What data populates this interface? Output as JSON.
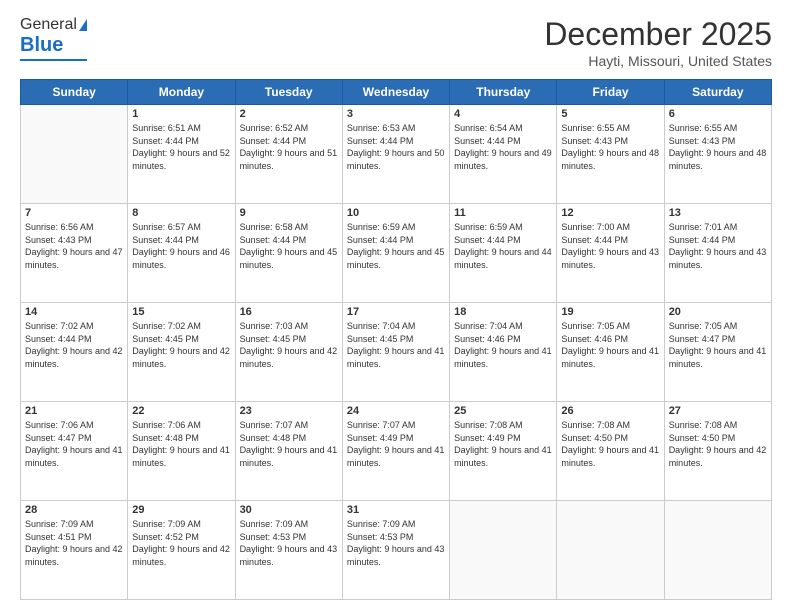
{
  "logo": {
    "line1": "General",
    "line2": "Blue"
  },
  "header": {
    "title": "December 2025",
    "location": "Hayti, Missouri, United States"
  },
  "weekdays": [
    "Sunday",
    "Monday",
    "Tuesday",
    "Wednesday",
    "Thursday",
    "Friday",
    "Saturday"
  ],
  "weeks": [
    [
      {
        "day": "",
        "sunrise": "",
        "sunset": "",
        "daylight": ""
      },
      {
        "day": "1",
        "sunrise": "Sunrise: 6:51 AM",
        "sunset": "Sunset: 4:44 PM",
        "daylight": "Daylight: 9 hours and 52 minutes."
      },
      {
        "day": "2",
        "sunrise": "Sunrise: 6:52 AM",
        "sunset": "Sunset: 4:44 PM",
        "daylight": "Daylight: 9 hours and 51 minutes."
      },
      {
        "day": "3",
        "sunrise": "Sunrise: 6:53 AM",
        "sunset": "Sunset: 4:44 PM",
        "daylight": "Daylight: 9 hours and 50 minutes."
      },
      {
        "day": "4",
        "sunrise": "Sunrise: 6:54 AM",
        "sunset": "Sunset: 4:44 PM",
        "daylight": "Daylight: 9 hours and 49 minutes."
      },
      {
        "day": "5",
        "sunrise": "Sunrise: 6:55 AM",
        "sunset": "Sunset: 4:43 PM",
        "daylight": "Daylight: 9 hours and 48 minutes."
      },
      {
        "day": "6",
        "sunrise": "Sunrise: 6:55 AM",
        "sunset": "Sunset: 4:43 PM",
        "daylight": "Daylight: 9 hours and 48 minutes."
      }
    ],
    [
      {
        "day": "7",
        "sunrise": "Sunrise: 6:56 AM",
        "sunset": "Sunset: 4:43 PM",
        "daylight": "Daylight: 9 hours and 47 minutes."
      },
      {
        "day": "8",
        "sunrise": "Sunrise: 6:57 AM",
        "sunset": "Sunset: 4:44 PM",
        "daylight": "Daylight: 9 hours and 46 minutes."
      },
      {
        "day": "9",
        "sunrise": "Sunrise: 6:58 AM",
        "sunset": "Sunset: 4:44 PM",
        "daylight": "Daylight: 9 hours and 45 minutes."
      },
      {
        "day": "10",
        "sunrise": "Sunrise: 6:59 AM",
        "sunset": "Sunset: 4:44 PM",
        "daylight": "Daylight: 9 hours and 45 minutes."
      },
      {
        "day": "11",
        "sunrise": "Sunrise: 6:59 AM",
        "sunset": "Sunset: 4:44 PM",
        "daylight": "Daylight: 9 hours and 44 minutes."
      },
      {
        "day": "12",
        "sunrise": "Sunrise: 7:00 AM",
        "sunset": "Sunset: 4:44 PM",
        "daylight": "Daylight: 9 hours and 43 minutes."
      },
      {
        "day": "13",
        "sunrise": "Sunrise: 7:01 AM",
        "sunset": "Sunset: 4:44 PM",
        "daylight": "Daylight: 9 hours and 43 minutes."
      }
    ],
    [
      {
        "day": "14",
        "sunrise": "Sunrise: 7:02 AM",
        "sunset": "Sunset: 4:44 PM",
        "daylight": "Daylight: 9 hours and 42 minutes."
      },
      {
        "day": "15",
        "sunrise": "Sunrise: 7:02 AM",
        "sunset": "Sunset: 4:45 PM",
        "daylight": "Daylight: 9 hours and 42 minutes."
      },
      {
        "day": "16",
        "sunrise": "Sunrise: 7:03 AM",
        "sunset": "Sunset: 4:45 PM",
        "daylight": "Daylight: 9 hours and 42 minutes."
      },
      {
        "day": "17",
        "sunrise": "Sunrise: 7:04 AM",
        "sunset": "Sunset: 4:45 PM",
        "daylight": "Daylight: 9 hours and 41 minutes."
      },
      {
        "day": "18",
        "sunrise": "Sunrise: 7:04 AM",
        "sunset": "Sunset: 4:46 PM",
        "daylight": "Daylight: 9 hours and 41 minutes."
      },
      {
        "day": "19",
        "sunrise": "Sunrise: 7:05 AM",
        "sunset": "Sunset: 4:46 PM",
        "daylight": "Daylight: 9 hours and 41 minutes."
      },
      {
        "day": "20",
        "sunrise": "Sunrise: 7:05 AM",
        "sunset": "Sunset: 4:47 PM",
        "daylight": "Daylight: 9 hours and 41 minutes."
      }
    ],
    [
      {
        "day": "21",
        "sunrise": "Sunrise: 7:06 AM",
        "sunset": "Sunset: 4:47 PM",
        "daylight": "Daylight: 9 hours and 41 minutes."
      },
      {
        "day": "22",
        "sunrise": "Sunrise: 7:06 AM",
        "sunset": "Sunset: 4:48 PM",
        "daylight": "Daylight: 9 hours and 41 minutes."
      },
      {
        "day": "23",
        "sunrise": "Sunrise: 7:07 AM",
        "sunset": "Sunset: 4:48 PM",
        "daylight": "Daylight: 9 hours and 41 minutes."
      },
      {
        "day": "24",
        "sunrise": "Sunrise: 7:07 AM",
        "sunset": "Sunset: 4:49 PM",
        "daylight": "Daylight: 9 hours and 41 minutes."
      },
      {
        "day": "25",
        "sunrise": "Sunrise: 7:08 AM",
        "sunset": "Sunset: 4:49 PM",
        "daylight": "Daylight: 9 hours and 41 minutes."
      },
      {
        "day": "26",
        "sunrise": "Sunrise: 7:08 AM",
        "sunset": "Sunset: 4:50 PM",
        "daylight": "Daylight: 9 hours and 41 minutes."
      },
      {
        "day": "27",
        "sunrise": "Sunrise: 7:08 AM",
        "sunset": "Sunset: 4:50 PM",
        "daylight": "Daylight: 9 hours and 42 minutes."
      }
    ],
    [
      {
        "day": "28",
        "sunrise": "Sunrise: 7:09 AM",
        "sunset": "Sunset: 4:51 PM",
        "daylight": "Daylight: 9 hours and 42 minutes."
      },
      {
        "day": "29",
        "sunrise": "Sunrise: 7:09 AM",
        "sunset": "Sunset: 4:52 PM",
        "daylight": "Daylight: 9 hours and 42 minutes."
      },
      {
        "day": "30",
        "sunrise": "Sunrise: 7:09 AM",
        "sunset": "Sunset: 4:53 PM",
        "daylight": "Daylight: 9 hours and 43 minutes."
      },
      {
        "day": "31",
        "sunrise": "Sunrise: 7:09 AM",
        "sunset": "Sunset: 4:53 PM",
        "daylight": "Daylight: 9 hours and 43 minutes."
      },
      {
        "day": "",
        "sunrise": "",
        "sunset": "",
        "daylight": ""
      },
      {
        "day": "",
        "sunrise": "",
        "sunset": "",
        "daylight": ""
      },
      {
        "day": "",
        "sunrise": "",
        "sunset": "",
        "daylight": ""
      }
    ]
  ]
}
